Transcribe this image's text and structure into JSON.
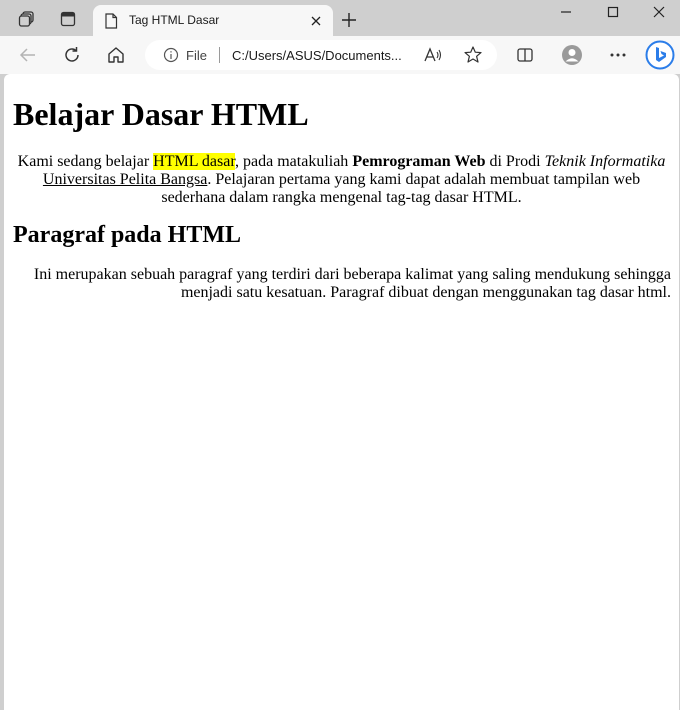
{
  "tab": {
    "title": "Tag HTML Dasar"
  },
  "address_bar": {
    "scheme_label": "File",
    "url": "C:/Users/ASUS/Documents...",
    "read_aloud_label": "Aͅ"
  },
  "page": {
    "heading": "Belajar Dasar HTML",
    "intro": {
      "t1": "Kami sedang belajar ",
      "highlight": "HTML dasar",
      "t2": ", pada matakuliah ",
      "bold": "Pemrograman Web",
      "t3": " di Prodi ",
      "italic": "Teknik Informatika",
      "t4": " ",
      "underline": "Universitas Pelita Bangsa",
      "t5": ". Pelajaran pertama yang kami dapat adalah membuat tampilan web sederhana dalam rangka mengenal tag-tag dasar HTML."
    },
    "subheading": "Paragraf pada HTML",
    "paragraph": "Ini merupakan sebuah paragraf yang terdiri dari beberapa kalimat yang saling mendukung sehingga menjadi satu kesatuan. Paragraf dibuat dengan menggunakan tag dasar html."
  },
  "colors": {
    "highlight": "#ffff00",
    "chrome": "#cfcfcf",
    "toolbar": "#f7f7f7"
  },
  "icons": [
    "workspaces-icon",
    "tab-actions-icon",
    "document-icon",
    "close-icon",
    "new-tab-icon",
    "minimize-icon",
    "maximize-icon",
    "window-close-icon",
    "back-icon",
    "refresh-icon",
    "home-icon",
    "info-icon",
    "read-aloud-icon",
    "favorite-star-icon",
    "split-screen-icon",
    "profile-icon",
    "more-icon",
    "bing-copilot-icon"
  ]
}
